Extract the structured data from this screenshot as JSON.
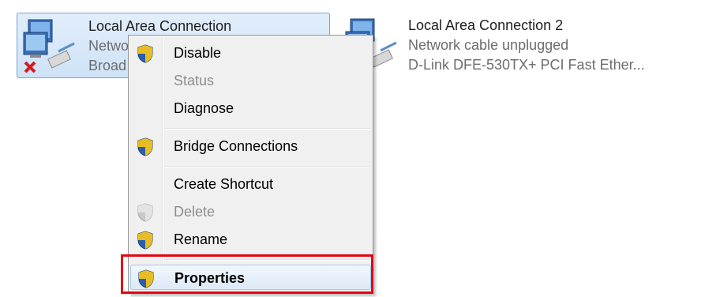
{
  "connections": [
    {
      "name": "Local Area Connection",
      "status": "Netwo",
      "device": "Broad",
      "icon": "network-disconnected-icon",
      "selected": true
    },
    {
      "name": "Local Area Connection 2",
      "status": "Network cable unplugged",
      "device": "D-Link DFE-530TX+ PCI Fast Ether...",
      "icon": "network-adapter-icon",
      "selected": false
    }
  ],
  "context_menu": {
    "items": [
      {
        "label": "Disable",
        "shield": true,
        "enabled": true
      },
      {
        "label": "Status",
        "shield": false,
        "enabled": false
      },
      {
        "label": "Diagnose",
        "shield": false,
        "enabled": true
      },
      {
        "label": "Bridge Connections",
        "shield": true,
        "enabled": true
      },
      {
        "label": "Create Shortcut",
        "shield": false,
        "enabled": true
      },
      {
        "label": "Delete",
        "shield": true,
        "enabled": false
      },
      {
        "label": "Rename",
        "shield": true,
        "enabled": true
      },
      {
        "label": "Properties",
        "shield": true,
        "enabled": true,
        "default": true
      }
    ]
  },
  "colors": {
    "highlight_box": "#e30613",
    "selection_border": "#7da2ce",
    "shield_blue": "#2a5fb0",
    "shield_yellow": "#f2c21b"
  }
}
